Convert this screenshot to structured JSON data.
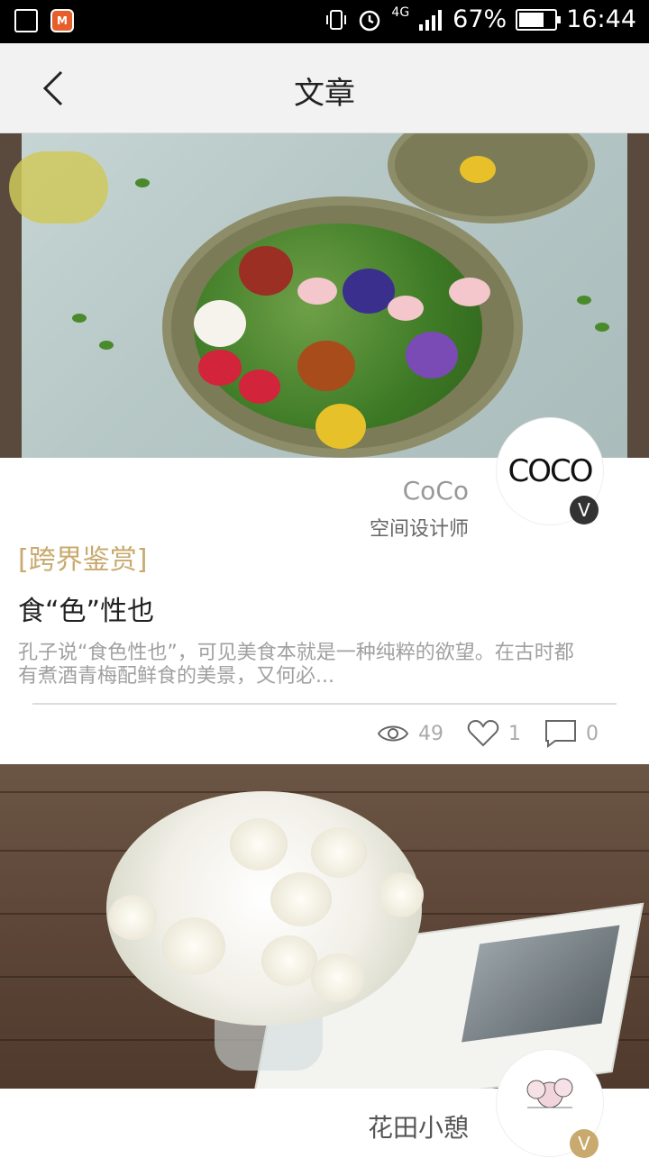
{
  "status_bar": {
    "signal_label": "4G",
    "battery_percent": "67%",
    "battery_level": 0.67,
    "time": "16:44"
  },
  "header": {
    "title": "文章"
  },
  "articles": [
    {
      "author_avatar_text": "COCO",
      "verified_badge": "V",
      "author_name": "CoCo",
      "author_role": "空间设计师",
      "tag": "[跨界鉴赏]",
      "title": "食“色”性也",
      "summary": "孔子说“食色性也”，可见美食本就是一种纯粹的欲望。在古时都有煮酒青梅配鲜食的美景，又何必...",
      "views": "49",
      "likes": "1",
      "comments": "0"
    },
    {
      "author_avatar_text": "FLORAL&LIFE",
      "verified_badge": "V",
      "author_name": "花田小憩"
    }
  ],
  "icons": {
    "back": "chevron-left-icon",
    "views": "eye-icon",
    "likes": "heart-icon",
    "comments": "comment-icon"
  },
  "colors": {
    "tag": "#c8aa6e",
    "badge_dark": "#333333",
    "badge_gold": "#c8aa6e"
  }
}
